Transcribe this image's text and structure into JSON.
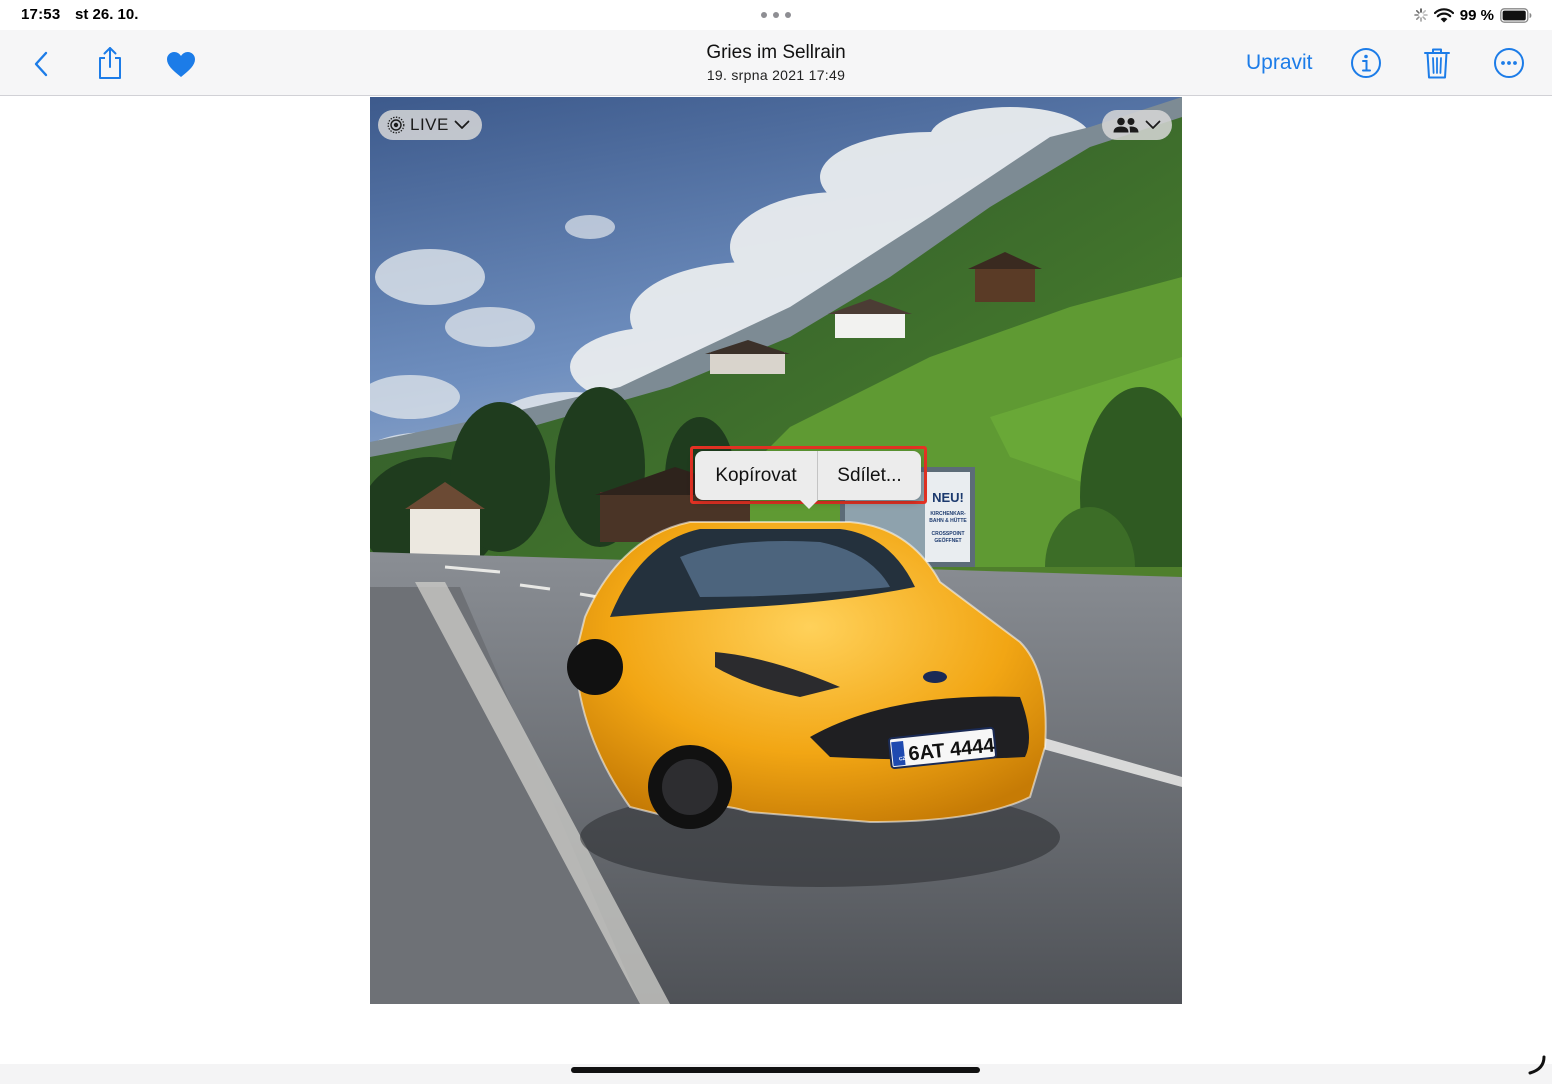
{
  "status_bar": {
    "time": "17:53",
    "date": "st 26. 10.",
    "battery_percent": "99 %",
    "battery_level": 0.99
  },
  "nav": {
    "title": "Gries im Sellrain",
    "subtitle": "19. srpna 2021  17:49",
    "edit_label": "Upravit",
    "favorite": true,
    "icons": {
      "back": "chevron-left-icon",
      "share": "share-icon",
      "favorite": "heart-icon",
      "info": "info-icon",
      "trash": "trash-icon",
      "more": "more-icon"
    }
  },
  "photo": {
    "live_label": "LIVE",
    "sign_headline": "NEU!",
    "sign_line1": "KIRCHENKAR-",
    "sign_line2": "BAHN & HÜTTE",
    "sign_line3": "CROSSPOINT",
    "sign_line4": "GEÖFFNET",
    "plate_country": "CZ",
    "plate_number": "6AT 4444"
  },
  "context_menu": {
    "items": [
      {
        "label": "Kopírovat"
      },
      {
        "label": "Sdílet..."
      }
    ]
  },
  "colors": {
    "accent": "#1C7CE8",
    "highlight": "#E53224",
    "car": "#F2A614"
  }
}
